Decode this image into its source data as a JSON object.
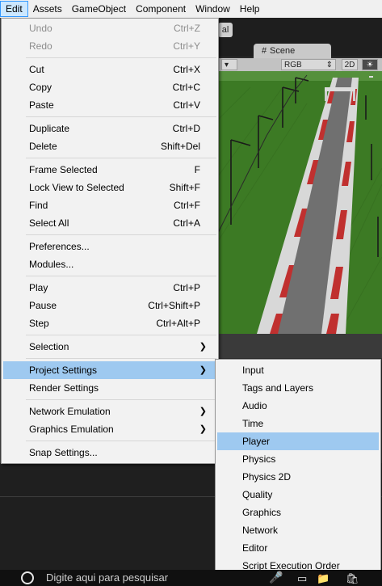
{
  "menubar": [
    {
      "label": "Edit",
      "active": true
    },
    {
      "label": "Assets"
    },
    {
      "label": "GameObject"
    },
    {
      "label": "Component"
    },
    {
      "label": "Window"
    },
    {
      "label": "Help"
    }
  ],
  "toolbar": {
    "partial_label": "al"
  },
  "scene": {
    "tab_label": "Scene",
    "tab_icon": "grid-icon",
    "rgb_label": "RGB",
    "mode_2d": "2D"
  },
  "edit_menu": {
    "items": [
      {
        "label": "Undo",
        "shortcut": "Ctrl+Z",
        "disabled": true
      },
      {
        "label": "Redo",
        "shortcut": "Ctrl+Y",
        "disabled": true
      },
      {
        "label": "Cut",
        "shortcut": "Ctrl+X"
      },
      {
        "label": "Copy",
        "shortcut": "Ctrl+C"
      },
      {
        "label": "Paste",
        "shortcut": "Ctrl+V"
      },
      {
        "label": "Duplicate",
        "shortcut": "Ctrl+D"
      },
      {
        "label": "Delete",
        "shortcut": "Shift+Del"
      },
      {
        "label": "Frame Selected",
        "shortcut": "F"
      },
      {
        "label": "Lock View to Selected",
        "shortcut": "Shift+F"
      },
      {
        "label": "Find",
        "shortcut": "Ctrl+F"
      },
      {
        "label": "Select All",
        "shortcut": "Ctrl+A"
      },
      {
        "label": "Preferences...",
        "shortcut": ""
      },
      {
        "label": "Modules...",
        "shortcut": ""
      },
      {
        "label": "Play",
        "shortcut": "Ctrl+P"
      },
      {
        "label": "Pause",
        "shortcut": "Ctrl+Shift+P"
      },
      {
        "label": "Step",
        "shortcut": "Ctrl+Alt+P"
      },
      {
        "label": "Selection",
        "submenu": true
      },
      {
        "label": "Project Settings",
        "submenu": true,
        "highlighted": true
      },
      {
        "label": "Render Settings"
      },
      {
        "label": "Network Emulation",
        "submenu": true
      },
      {
        "label": "Graphics Emulation",
        "submenu": true
      },
      {
        "label": "Snap Settings..."
      }
    ]
  },
  "project_settings_menu": {
    "items": [
      {
        "label": "Input"
      },
      {
        "label": "Tags and Layers"
      },
      {
        "label": "Audio"
      },
      {
        "label": "Time"
      },
      {
        "label": "Player",
        "highlighted": true
      },
      {
        "label": "Physics"
      },
      {
        "label": "Physics 2D"
      },
      {
        "label": "Quality"
      },
      {
        "label": "Graphics"
      },
      {
        "label": "Network"
      },
      {
        "label": "Editor"
      },
      {
        "label": "Script Execution Order"
      }
    ]
  },
  "taskbar": {
    "search_placeholder": "Digite aqui para pesquisar",
    "icons": [
      "windows-start-icon",
      "search-icon",
      "microphone-icon",
      "task-view-icon",
      "file-explorer-icon",
      "store-icon"
    ]
  },
  "colors": {
    "menu_bg": "#f2f2f2",
    "highlight": "#9ec9f0",
    "grass": "#3e7d25",
    "road": "#6f6f6f"
  }
}
